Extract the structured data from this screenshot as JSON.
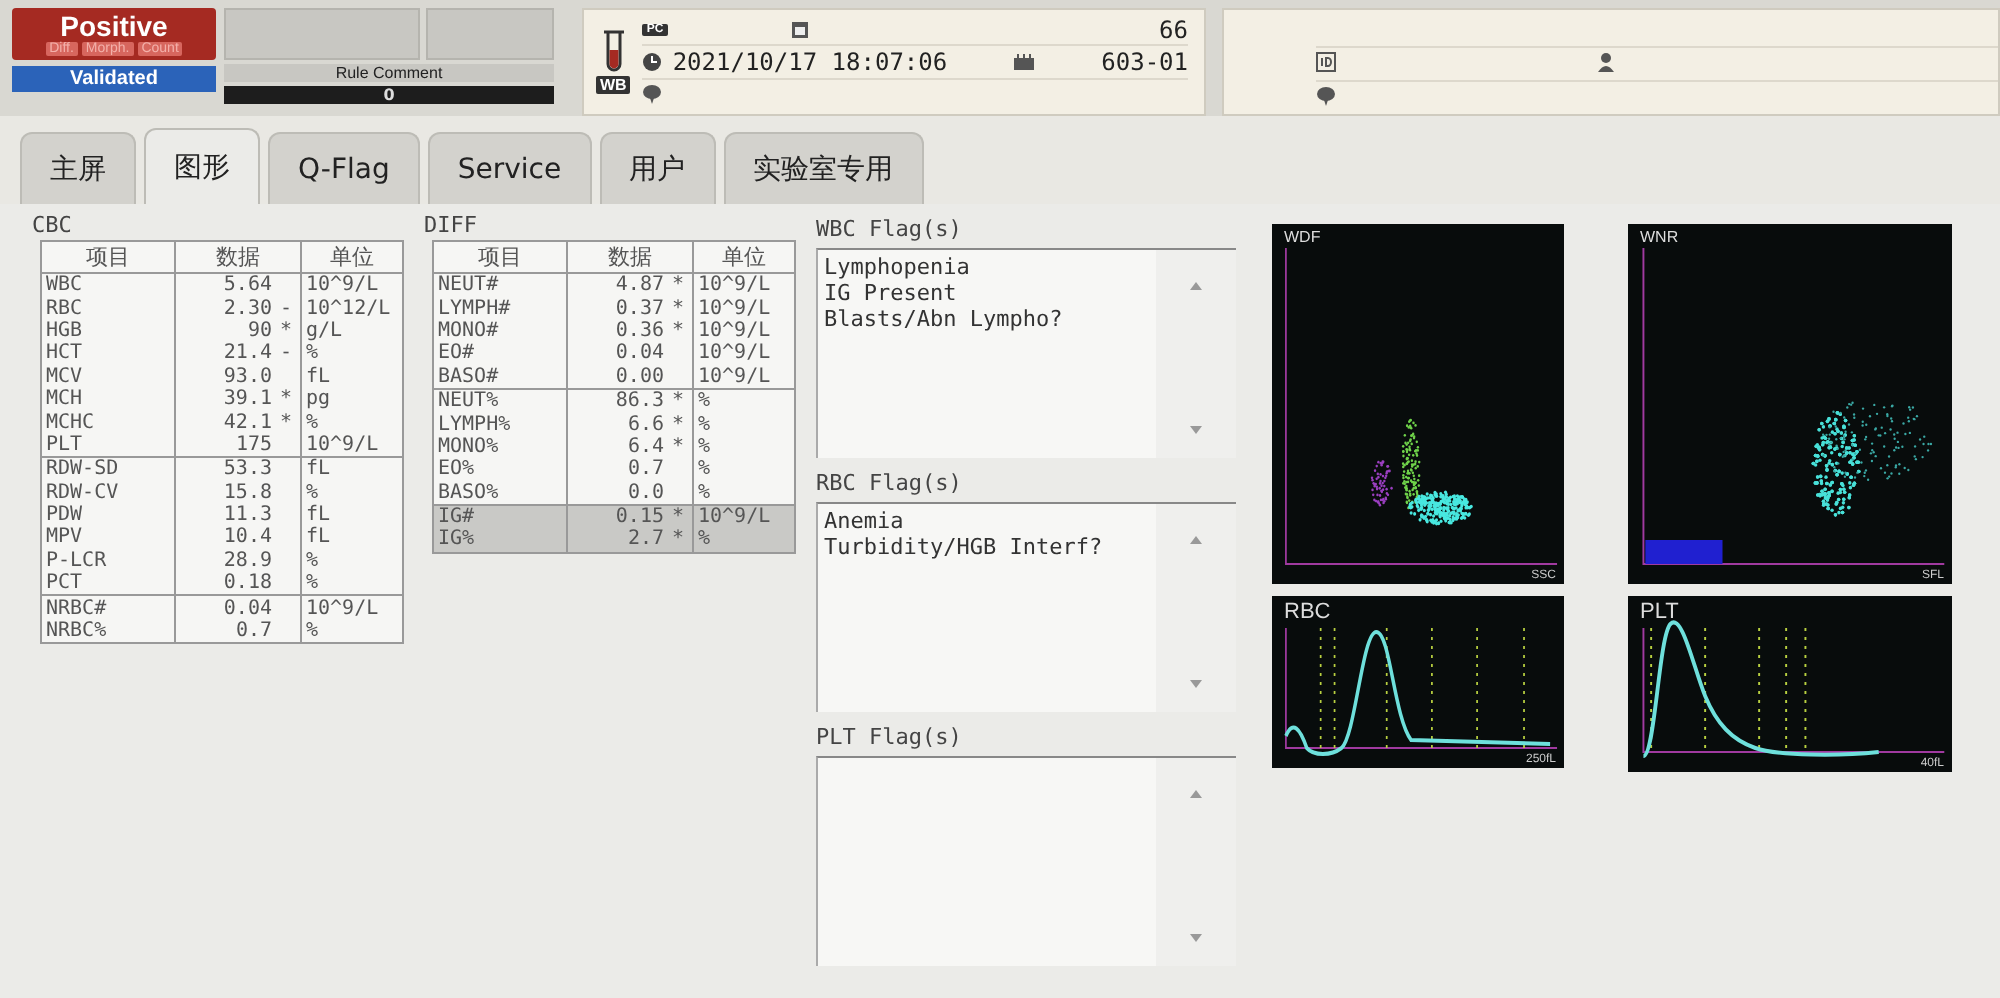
{
  "status": {
    "result": "Positive",
    "tags": [
      "Diff.",
      "Morph.",
      "Count"
    ],
    "validation": "Validated"
  },
  "rule_comment": {
    "label": "Rule Comment",
    "value": "0"
  },
  "sample": {
    "tube_badge": "WB",
    "mode_badge": "PC",
    "number": "66",
    "datetime": "2021/10/17 18:07:06",
    "rack": "603-01"
  },
  "tabs": [
    {
      "label": "主屏",
      "selected": false
    },
    {
      "label": "图形",
      "selected": true
    },
    {
      "label": "Q-Flag",
      "selected": false
    },
    {
      "label": "Service",
      "selected": false
    },
    {
      "label": "用户",
      "selected": false
    },
    {
      "label": "实验室专用",
      "selected": false
    }
  ],
  "tables": [
    {
      "title": "CBC",
      "columns": [
        "项目",
        "数据",
        "单位"
      ],
      "groups": [
        [
          {
            "item": "WBC",
            "value": "5.64",
            "unit": "10^9/L",
            "highlighted": false
          },
          {
            "item": "RBC",
            "value": "2.30",
            "flag": "-",
            "unit": "10^12/L",
            "highlighted": false
          },
          {
            "item": "HGB",
            "value": "90",
            "flag": "*",
            "unit": "g/L",
            "highlighted": false
          },
          {
            "item": "HCT",
            "value": "21.4",
            "flag": "-",
            "unit": "%",
            "highlighted": false
          },
          {
            "item": "MCV",
            "value": "93.0",
            "unit": "fL",
            "highlighted": false
          },
          {
            "item": "MCH",
            "value": "39.1",
            "flag": "*",
            "unit": "pg",
            "highlighted": false
          },
          {
            "item": "MCHC",
            "value": "42.1",
            "flag": "*",
            "unit": "%",
            "highlighted": false
          },
          {
            "item": "PLT",
            "value": "175",
            "unit": "10^9/L",
            "highlighted": false
          }
        ],
        [
          {
            "item": "RDW-SD",
            "value": "53.3",
            "unit": "fL",
            "highlighted": false
          },
          {
            "item": "RDW-CV",
            "value": "15.8",
            "unit": "%",
            "highlighted": false
          },
          {
            "item": "PDW",
            "value": "11.3",
            "unit": "fL",
            "highlighted": false
          },
          {
            "item": "MPV",
            "value": "10.4",
            "unit": "fL",
            "highlighted": false
          },
          {
            "item": "P-LCR",
            "value": "28.9",
            "unit": "%",
            "highlighted": false
          },
          {
            "item": "PCT",
            "value": "0.18",
            "unit": "%",
            "highlighted": false
          }
        ],
        [
          {
            "item": "NRBC#",
            "value": "0.04",
            "unit": "10^9/L",
            "highlighted": false
          },
          {
            "item": "NRBC%",
            "value": "0.7",
            "unit": "%",
            "highlighted": false
          }
        ]
      ]
    },
    {
      "title": "DIFF",
      "columns": [
        "项目",
        "数据",
        "单位"
      ],
      "groups": [
        [
          {
            "item": "NEUT#",
            "value": "4.87",
            "flag": "*",
            "unit": "10^9/L",
            "highlighted": false
          },
          {
            "item": "LYMPH#",
            "value": "0.37",
            "flag": "*",
            "unit": "10^9/L",
            "highlighted": false
          },
          {
            "item": "MONO#",
            "value": "0.36",
            "flag": "*",
            "unit": "10^9/L",
            "highlighted": false
          },
          {
            "item": "EO#",
            "value": "0.04",
            "unit": "10^9/L",
            "highlighted": false
          },
          {
            "item": "BASO#",
            "value": "0.00",
            "unit": "10^9/L",
            "highlighted": false
          }
        ],
        [
          {
            "item": "NEUT%",
            "value": "86.3",
            "flag": "*",
            "unit": "%",
            "highlighted": false
          },
          {
            "item": "LYMPH%",
            "value": "6.6",
            "flag": "*",
            "unit": "%",
            "highlighted": false
          },
          {
            "item": "MONO%",
            "value": "6.4",
            "flag": "*",
            "unit": "%",
            "highlighted": false
          },
          {
            "item": "EO%",
            "value": "0.7",
            "unit": "%",
            "highlighted": false
          },
          {
            "item": "BASO%",
            "value": "0.0",
            "unit": "%",
            "highlighted": false
          }
        ],
        [
          {
            "item": "IG#",
            "value": "0.15",
            "flag": "*",
            "unit": "10^9/L",
            "highlighted": true
          },
          {
            "item": "IG%",
            "value": "2.7",
            "flag": "*",
            "unit": "%",
            "highlighted": true
          }
        ]
      ]
    }
  ],
  "flags": [
    {
      "title": "WBC Flag(s)",
      "lines": [
        "Lymphopenia",
        "IG Present",
        "Blasts/Abn Lympho?"
      ]
    },
    {
      "title": "RBC Flag(s)",
      "lines": [
        "Anemia",
        "Turbidity/HGB Interf?"
      ]
    },
    {
      "title": "PLT Flag(s)"
    }
  ],
  "plots": [
    {
      "kind": "scatter",
      "title": "WDF",
      "x_axis": "SSC"
    },
    {
      "kind": "scatter",
      "title": "WNR",
      "x_axis": "SFL"
    },
    {
      "kind": "histogram",
      "title": "RBC",
      "x_axis": "250fL"
    },
    {
      "kind": "histogram",
      "title": "PLT",
      "x_axis": "40fL"
    }
  ]
}
